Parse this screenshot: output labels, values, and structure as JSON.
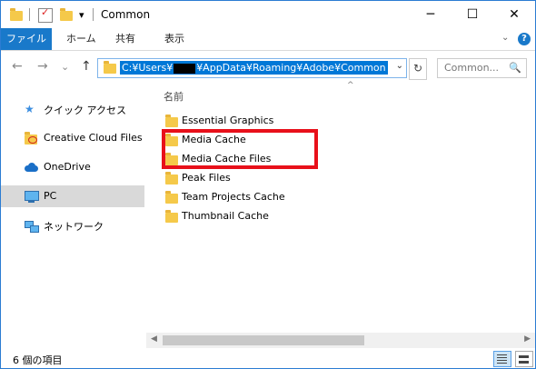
{
  "window": {
    "title": "Common",
    "minimize_glyph": "─",
    "maximize_glyph": "☐",
    "close_glyph": "✕"
  },
  "quick_access_toolbar": {
    "dropdown_glyph": "▾"
  },
  "ribbon": {
    "file_tab": "ファイル",
    "tabs": [
      "ホーム",
      "共有",
      "表示"
    ],
    "collapse_glyph": "⌄",
    "help_glyph": "?"
  },
  "navigation": {
    "back_glyph": "←",
    "forward_glyph": "→",
    "recent_glyph": "⌄",
    "up_glyph": "↑",
    "address_prefix": "C:¥Users¥",
    "address_suffix": "¥AppData¥Roaming¥Adobe¥Common",
    "address_dropdown_glyph": "⌄",
    "refresh_glyph": "↻",
    "search_placeholder": "Common...",
    "search_glyph": "🔍"
  },
  "nav_pane": {
    "items": [
      {
        "label": "クイック アクセス",
        "icon": "star-icon"
      },
      {
        "label": "Creative Cloud Files",
        "icon": "creative-cloud-icon"
      },
      {
        "label": "OneDrive",
        "icon": "onedrive-icon"
      },
      {
        "label": "PC",
        "icon": "pc-icon"
      },
      {
        "label": "ネットワーク",
        "icon": "network-icon"
      }
    ]
  },
  "content": {
    "column_header": "名前",
    "sort_glyph": "^",
    "files": [
      "Essential Graphics",
      "Media Cache",
      "Media Cache Files",
      "Peak Files",
      "Team Projects Cache",
      "Thumbnail Cache"
    ]
  },
  "scrollbar": {
    "left_glyph": "◀",
    "right_glyph": "▶"
  },
  "status": {
    "item_count": "6 個の項目"
  },
  "colors": {
    "accent": "#1979ca",
    "highlight_box": "#e8101a",
    "folder": "#f5c94a"
  }
}
